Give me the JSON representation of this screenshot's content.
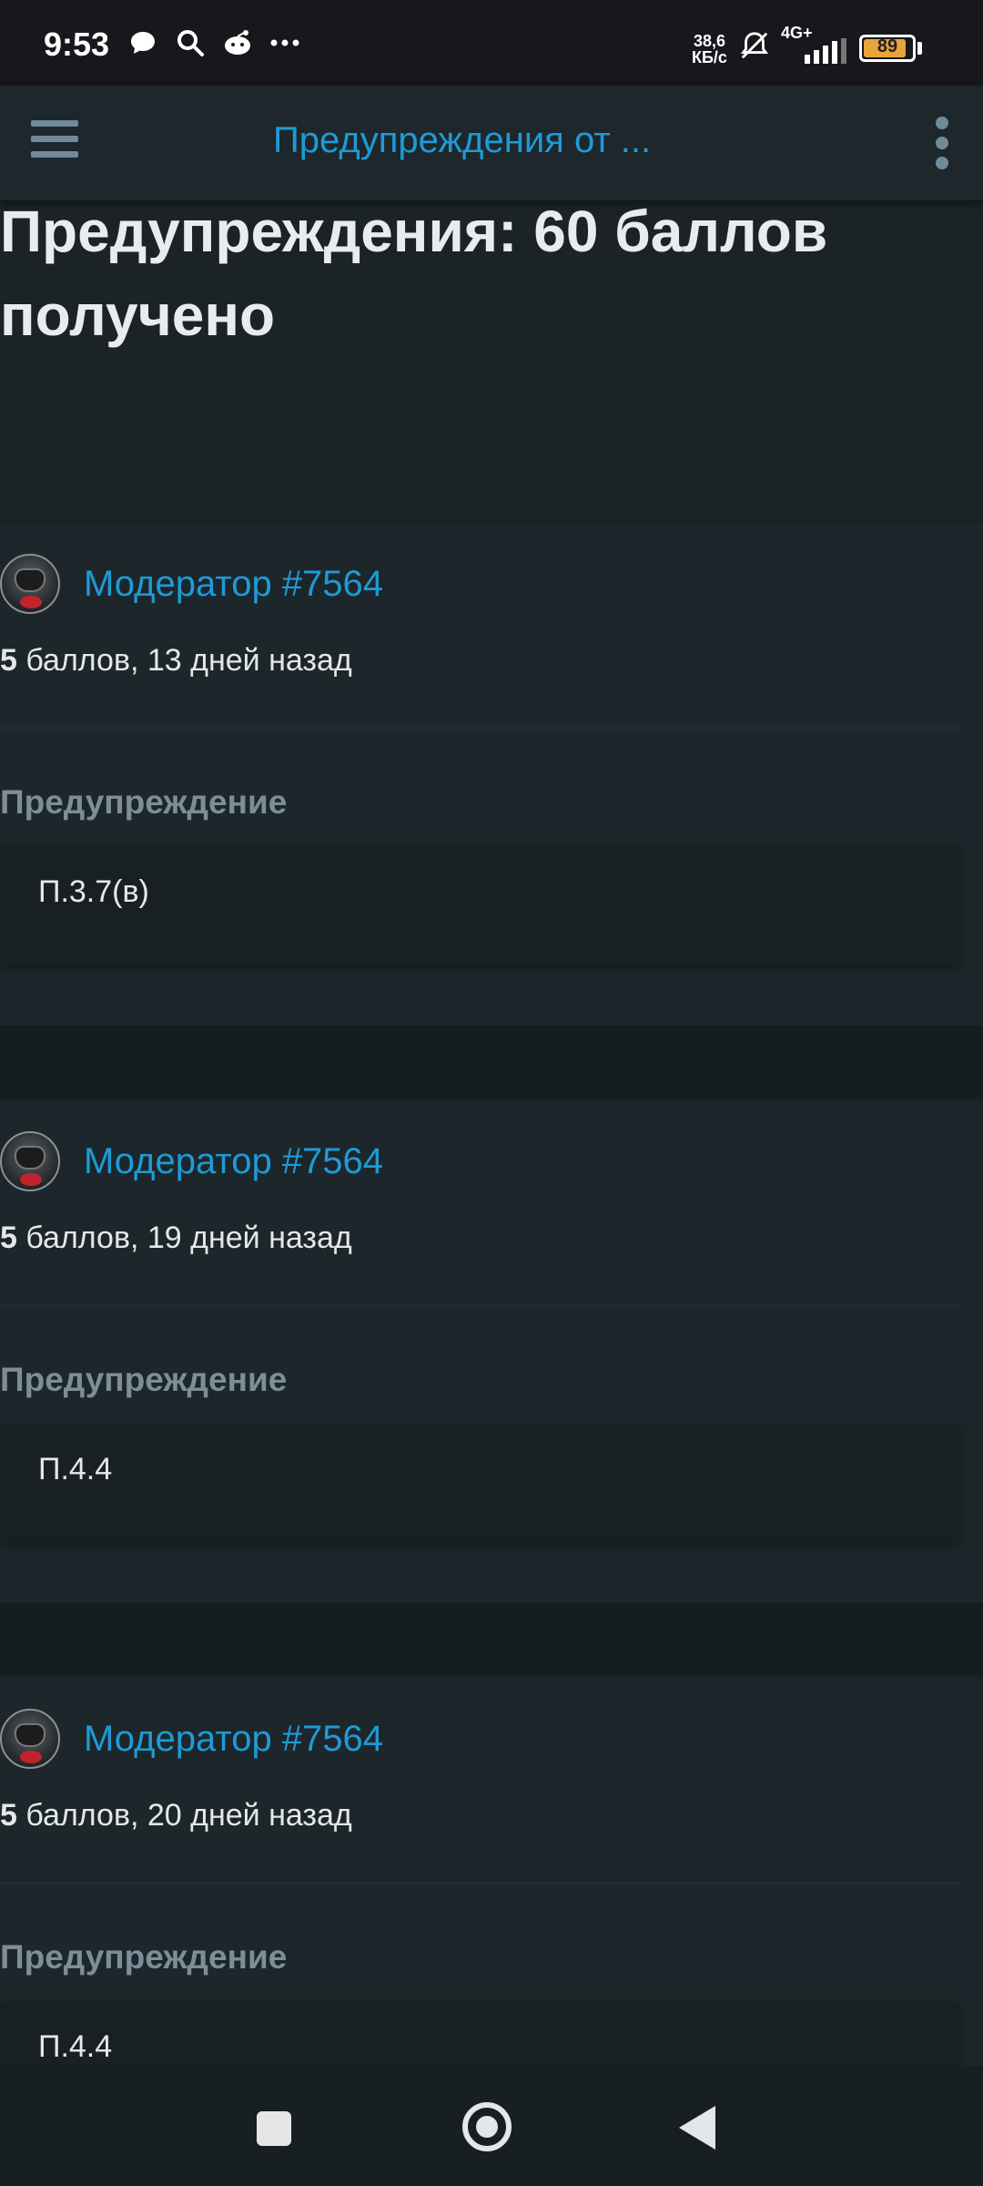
{
  "status_bar": {
    "time": "9:53",
    "icons": [
      "chat-bubble-icon",
      "search-icon",
      "reddit-icon",
      "more-notifications-icon"
    ],
    "net_speed_value": "38,6",
    "net_speed_unit": "КБ/с",
    "network": "4G+",
    "battery": "89",
    "battery_level": 0.89
  },
  "appbar": {
    "title": "Предупреждения от ...",
    "menu_icon": "hamburger-menu-icon",
    "more_icon": "kebab-menu-icon"
  },
  "page": {
    "title": "Предупреждения: 60 баллов получено"
  },
  "warnings": [
    {
      "author": "Модератор #7564",
      "points": "5",
      "points_suffix": " баллов, 13 дней назад",
      "label": "Предупреждение",
      "reason": "П.3.7(в)"
    },
    {
      "author": "Модератор #7564",
      "points": "5",
      "points_suffix": " баллов, 19 дней назад",
      "label": "Предупреждение",
      "reason": "П.4.4"
    },
    {
      "author": "Модератор #7564",
      "points": "5",
      "points_suffix": " баллов, 20 дней назад",
      "label": "Предупреждение",
      "reason": "П.4.4"
    }
  ],
  "colors": {
    "accent": "#1d9bd6",
    "background": "#1b2327",
    "label": "#7c8e98"
  }
}
